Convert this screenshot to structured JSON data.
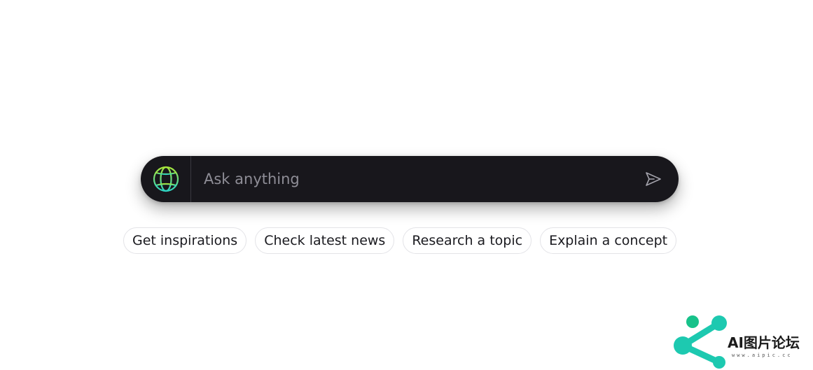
{
  "search": {
    "placeholder": "Ask anything",
    "value": "",
    "globe_icon": "globe-icon",
    "send_icon": "paper-plane-icon",
    "bar_color": "#18171c",
    "globe_gradient": [
      "#a8e63a",
      "#2ed3c2"
    ]
  },
  "suggestions": [
    {
      "label": "Get inspirations"
    },
    {
      "label": "Check latest news"
    },
    {
      "label": "Research a topic"
    },
    {
      "label": "Explain a concept"
    }
  ],
  "watermark": {
    "title": "AI图片论坛",
    "subtitle": "www.aipic.cc",
    "logo_color": "#1dc9b0"
  }
}
